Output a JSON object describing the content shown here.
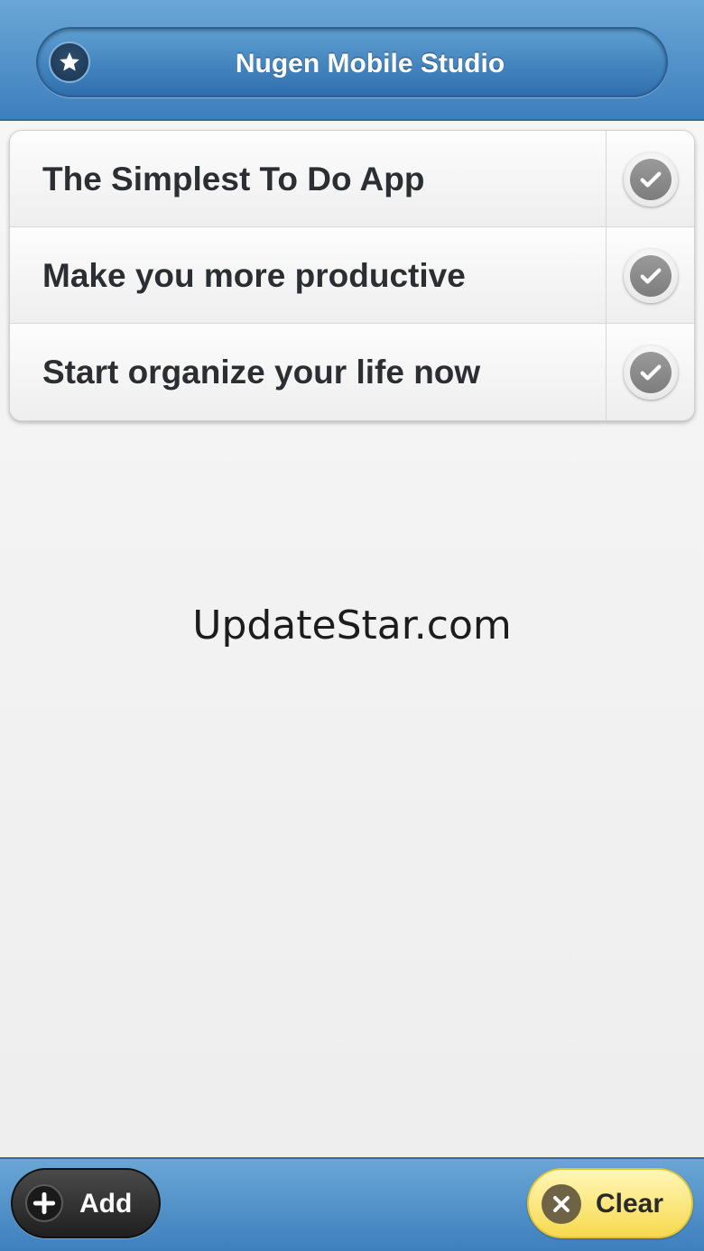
{
  "header": {
    "title": "Nugen Mobile Studio",
    "star_icon": "star-icon"
  },
  "todos": [
    {
      "label": "The Simplest To Do App",
      "icon": "check-icon"
    },
    {
      "label": "Make you more productive",
      "icon": "check-icon"
    },
    {
      "label": "Start organize your life now",
      "icon": "check-icon"
    }
  ],
  "watermark": "UpdateStar.com",
  "footer": {
    "add_label": "Add",
    "add_icon": "plus-icon",
    "clear_label": "Clear",
    "clear_icon": "close-icon"
  },
  "colors": {
    "header_blue": "#3e7fbd",
    "clear_yellow": "#f7d94e",
    "add_dark": "#1f1f1f"
  }
}
